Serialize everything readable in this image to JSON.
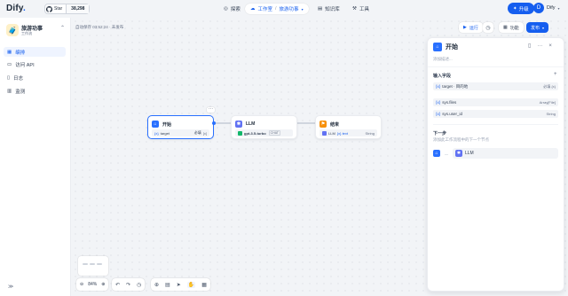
{
  "logo": {
    "text": "Dify",
    "dot": "."
  },
  "github": {
    "label": "Star",
    "count": "38,298"
  },
  "nav": [
    {
      "label": "探索",
      "icon": "compass-icon"
    },
    {
      "label": "工作室",
      "sub": "旅游功事",
      "icon": "studio-icon"
    },
    {
      "label": "知识库",
      "icon": "book-icon"
    },
    {
      "label": "工具",
      "icon": "tool-icon"
    }
  ],
  "upgrade": {
    "label": "升级"
  },
  "user": {
    "avatar": "D",
    "name": "Dify"
  },
  "app": {
    "icon": "🧳",
    "name": "旅游功事",
    "type": "工作流"
  },
  "sidebar": {
    "items": [
      {
        "label": "编排",
        "icon": "grid-icon"
      },
      {
        "label": "访问 API",
        "icon": "terminal-icon"
      },
      {
        "label": "日志",
        "icon": "file-icon"
      },
      {
        "label": "监测",
        "icon": "chart-icon"
      }
    ],
    "collapse": "≫"
  },
  "autosave": "自动保存 03:52:24 · 未发布",
  "actions": {
    "run": "运行",
    "feature": "功能",
    "publish": "发布"
  },
  "nodes": {
    "start": {
      "title": "开始",
      "var": "target",
      "required": "必填",
      "dots": "···"
    },
    "llm": {
      "title": "LLM",
      "model": "gpt-3.5-turbo",
      "mode": "CHAT"
    },
    "end": {
      "title": "结束",
      "var": "LLM",
      "var_sub": "{x} text",
      "type": "String"
    }
  },
  "zoom": {
    "value": "84%"
  },
  "panel": {
    "title": "开始",
    "desc": "添加描述...",
    "inputs_title": "输入字段",
    "vars": [
      {
        "name": "target · 目的地",
        "meta": "必填  {x}"
      },
      {
        "name": "sys.files",
        "meta": "Array[File]"
      },
      {
        "name": "sys.user_id",
        "meta": "String"
      }
    ],
    "next_title": "下一步",
    "next_desc": "添加此工作流程中的下一个节点",
    "next_node": "LLM"
  },
  "colors": {
    "accent": "#155eef",
    "start": "#2970ff",
    "llm": "#6172f3",
    "end": "#f79009"
  }
}
